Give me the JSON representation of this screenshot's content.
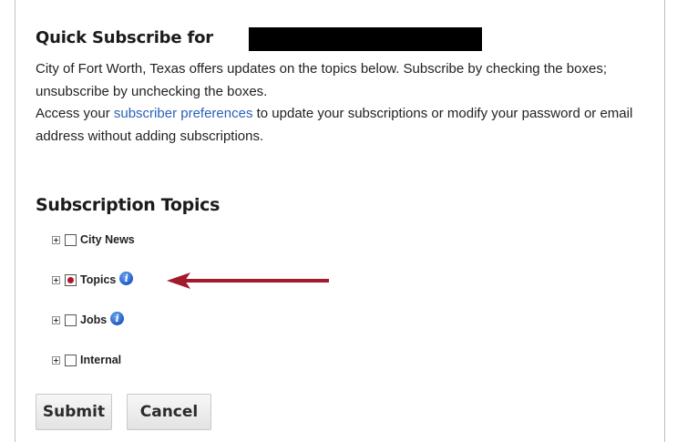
{
  "header": {
    "title": "Quick Subscribe for"
  },
  "description": {
    "line1": "City of Fort Worth, Texas offers updates on the topics below. Subscribe by checking the boxes; unsubscribe by unchecking the boxes.",
    "access_prefix": "Access your ",
    "link_text": "subscriber preferences",
    "access_suffix": " to update your subscriptions or modify your password or email address without adding subscriptions."
  },
  "topics_section": {
    "heading": "Subscription Topics",
    "items": [
      {
        "label": "City News",
        "checked": false,
        "info_icon": false
      },
      {
        "label": "Topics",
        "checked": true,
        "info_icon": true
      },
      {
        "label": "Jobs",
        "checked": false,
        "info_icon": true
      },
      {
        "label": "Internal",
        "checked": false,
        "info_icon": false
      }
    ]
  },
  "annotation": {
    "arrow_color": "#a31a2c"
  },
  "buttons": {
    "submit_label": "Submit",
    "cancel_label": "Cancel"
  },
  "colors": {
    "link": "#2a62b8",
    "checked_dot": "#b3132b"
  }
}
